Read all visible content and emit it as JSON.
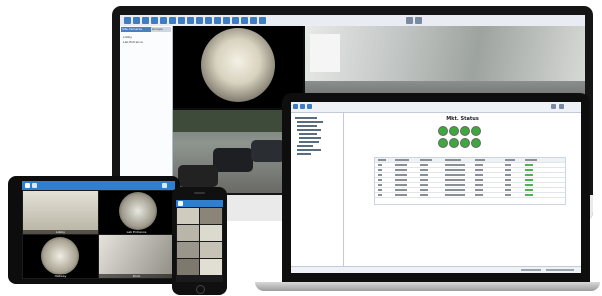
{
  "imac": {
    "sidebar_tabs": [
      "Site Cameras",
      "Groups"
    ],
    "sidebar_items": [
      "Lobby",
      "Lab Entrance"
    ],
    "toolbar_icons": [
      "camera-icon",
      "grid-icon",
      "grid-icon",
      "grid-icon",
      "grid-icon",
      "grid-icon",
      "grid-icon",
      "grid-icon",
      "grid-icon",
      "grid-icon",
      "grid-icon",
      "grid-icon",
      "grid-icon",
      "grid-icon",
      "grid-icon",
      "grid-icon"
    ]
  },
  "laptop": {
    "title": "Mkt. Status",
    "status_left": "",
    "status_right": ""
  },
  "tablet": {
    "captions": [
      "Lobby",
      "Lab Entrance",
      "Hallway",
      "Dock"
    ]
  },
  "colors": {
    "toolbar_blue": "#3e7cc4",
    "mobile_blue": "#2f7fd0",
    "status_green": "#3ea83e"
  }
}
